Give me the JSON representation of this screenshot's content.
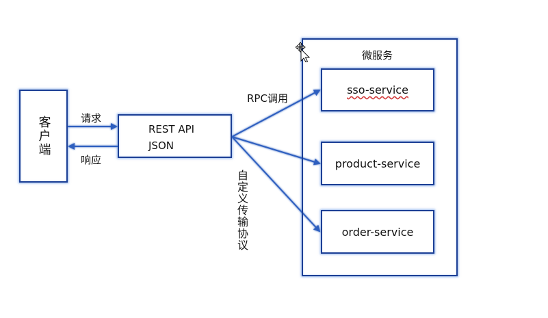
{
  "client": {
    "label": "客户端"
  },
  "api": {
    "line1": "REST API",
    "line2": "JSON"
  },
  "arrows": {
    "request_label": "请求",
    "response_label": "响应",
    "rpc_label": "RPC调用",
    "protocol_label": "自定义传输协议"
  },
  "microservices": {
    "title": "微服务",
    "services": [
      "sso-service",
      "product-service",
      "order-service"
    ]
  },
  "colors": {
    "border": "#1c3f95",
    "connector": "#2f5fbf",
    "glow": "#3a78dc"
  },
  "icons": {
    "cursor": "move-cursor-icon"
  }
}
